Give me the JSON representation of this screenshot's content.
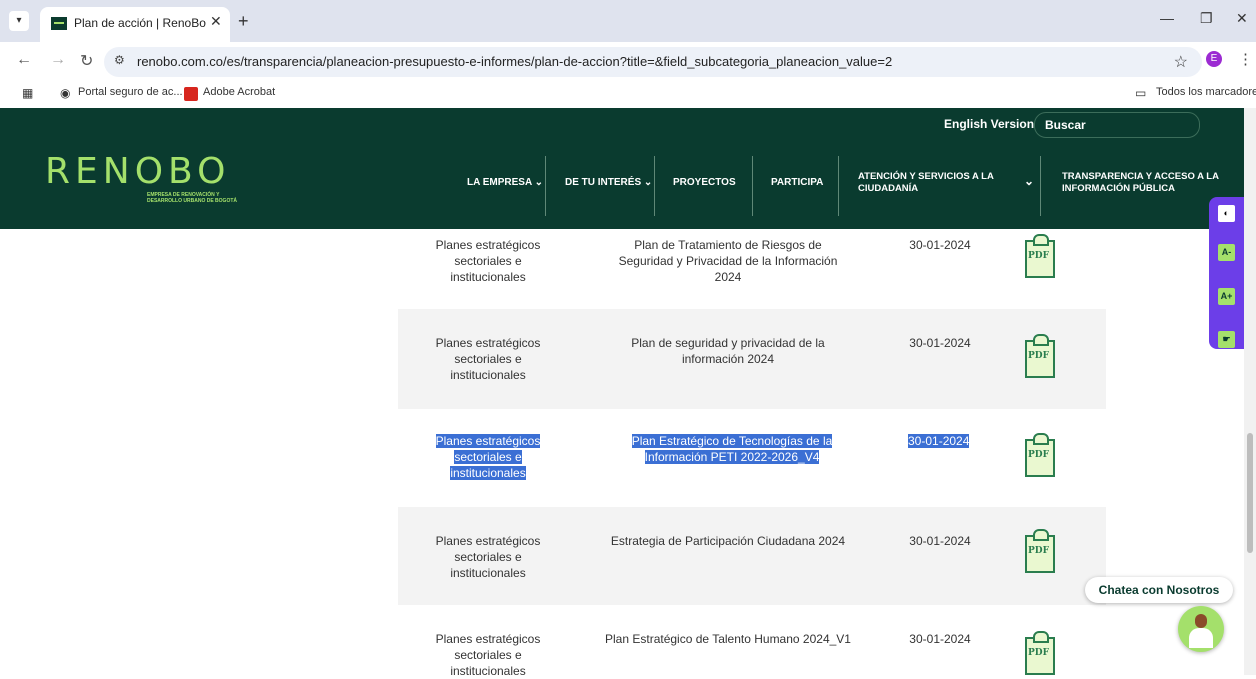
{
  "browser": {
    "tab_title": "Plan de acción | RenoBo",
    "url": "renobo.com.co/es/transparencia/planeacion-presupuesto-e-informes/plan-de-accion?title=&field_subcategoria_planeacion_value=2",
    "profile_initial": "E",
    "bookmarks": [
      "Portal seguro de ac...",
      "Adobe Acrobat"
    ],
    "all_bookmarks": "Todos los marcadores"
  },
  "header": {
    "logo_text": "RENOBO",
    "logo_subtitle": "EMPRESA DE RENOVACIÓN Y DESARROLLO URBANO DE BOGOTÁ",
    "english_version": "English Version",
    "search_label": "Buscar",
    "menu": [
      "LA EMPRESA",
      "DE TU INTERÉS",
      "PROYECTOS",
      "PARTICIPA",
      "ATENCIÓN Y SERVICIOS A LA CIUDADANÍA",
      "TRANSPARENCIA Y ACCESO A LA INFORMACIÓN PÚBLICA"
    ]
  },
  "rows": [
    {
      "category": "Planes estratégicos sectoriales e institucionales",
      "title": "Plan de Tratamiento de Riesgos de Seguridad y Privacidad de la Información 2024",
      "date": "30-01-2024",
      "file": "PDF"
    },
    {
      "category": "Planes estratégicos sectoriales e institucionales",
      "title": "Plan de seguridad y privacidad de la información 2024",
      "date": "30-01-2024",
      "file": "PDF"
    },
    {
      "category": "Planes estratégicos sectoriales e institucionales",
      "title": "Plan Estratégico de Tecnologías de la Información PETI 2022-2026_V4",
      "date": "30-01-2024",
      "file": "PDF"
    },
    {
      "category": "Planes estratégicos sectoriales e institucionales",
      "title": "Estrategia de Participación Ciudadana 2024",
      "date": "30-01-2024",
      "file": "PDF"
    },
    {
      "category": "Planes estratégicos sectoriales e institucionales",
      "title": "Plan Estratégico de Talento Humano 2024_V1",
      "date": "30-01-2024",
      "file": "PDF"
    }
  ],
  "accessibility": [
    "A-",
    "A+"
  ],
  "chat_label": "Chatea con Nosotros",
  "colors": {
    "brand_dark": "#0a3b2f",
    "brand_accent": "#a4e06b",
    "access_bar": "#6c3ee8",
    "selection": "#3b6fd4"
  }
}
